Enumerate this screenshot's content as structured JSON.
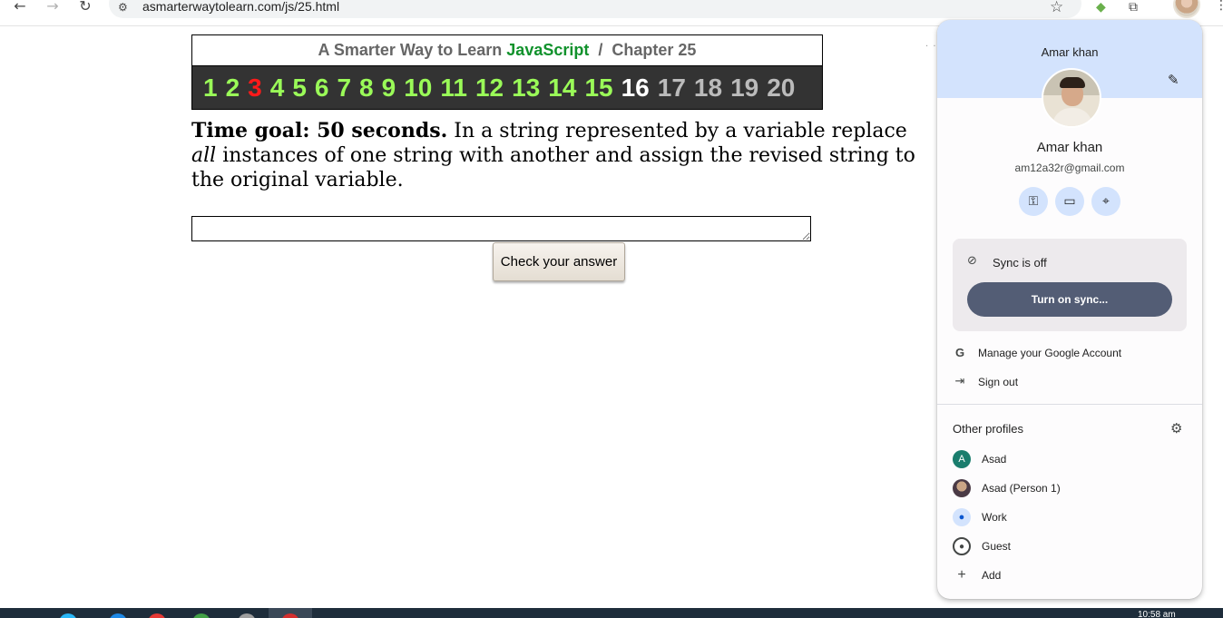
{
  "browser": {
    "url": "asmarterwaytolearn.com/js/25.html",
    "icons": [
      "back-arrow-icon",
      "forward-arrow-icon",
      "reload-icon",
      "site-info-icon",
      "bookmark-star-icon",
      "extension-icon",
      "extensions-puzzle-icon",
      "profile-avatar",
      "more-menu-icon"
    ]
  },
  "page": {
    "header_prefix": "A Smarter Way to Learn",
    "header_brand": "JavaScript",
    "header_separator": "/",
    "header_chapter": "Chapter 25",
    "chapters": [
      {
        "label": "1",
        "state": "done"
      },
      {
        "label": "2",
        "state": "done"
      },
      {
        "label": "3",
        "state": "red"
      },
      {
        "label": "4",
        "state": "done"
      },
      {
        "label": "5",
        "state": "done"
      },
      {
        "label": "6",
        "state": "done"
      },
      {
        "label": "7",
        "state": "done"
      },
      {
        "label": "8",
        "state": "done"
      },
      {
        "label": "9",
        "state": "done"
      },
      {
        "label": "10",
        "state": "done"
      },
      {
        "label": "11",
        "state": "done"
      },
      {
        "label": "12",
        "state": "done"
      },
      {
        "label": "13",
        "state": "done"
      },
      {
        "label": "14",
        "state": "done"
      },
      {
        "label": "15",
        "state": "done"
      },
      {
        "label": "16",
        "state": "current"
      },
      {
        "label": "17",
        "state": "todo"
      },
      {
        "label": "18",
        "state": "todo"
      },
      {
        "label": "19",
        "state": "todo"
      },
      {
        "label": "20",
        "state": "todo"
      }
    ],
    "question_bold": "Time goal: 50 seconds.",
    "question_pre": "In a string represented by a variable replace",
    "question_italic": "all",
    "question_post": "instances of one string with another and assign the revised string to the original variable.",
    "answer_value": "",
    "check_button": "Check your answer",
    "colors": {
      "done": "#9afa58",
      "red": "#ff1a1a",
      "current": "#ffffff",
      "todo": "#bbbbbb",
      "brand": "#11922c",
      "bar": "#333333"
    }
  },
  "profile_panel": {
    "header_name": "Amar khan",
    "name": "Amar khan",
    "email": "am12a32r@gmail.com",
    "quick_actions": [
      "password-key-icon",
      "payment-card-icon",
      "location-pin-icon"
    ],
    "sync_status": "Sync is off",
    "sync_button": "Turn on sync...",
    "manage_account": "Manage your Google Account",
    "sign_out": "Sign out",
    "other_profiles_title": "Other profiles",
    "profiles": [
      {
        "name": "Asad",
        "avatar": "A",
        "kind": "letter"
      },
      {
        "name": "Asad (Person 1)",
        "avatar": "",
        "kind": "photo"
      },
      {
        "name": "Work",
        "avatar": "",
        "kind": "work"
      },
      {
        "name": "Guest",
        "avatar": "",
        "kind": "guest"
      }
    ],
    "add_label": "Add",
    "accent_color": "#d3e3fd",
    "sync_button_color": "#535d75"
  },
  "taskbar": {
    "clock": "10:58 am"
  }
}
